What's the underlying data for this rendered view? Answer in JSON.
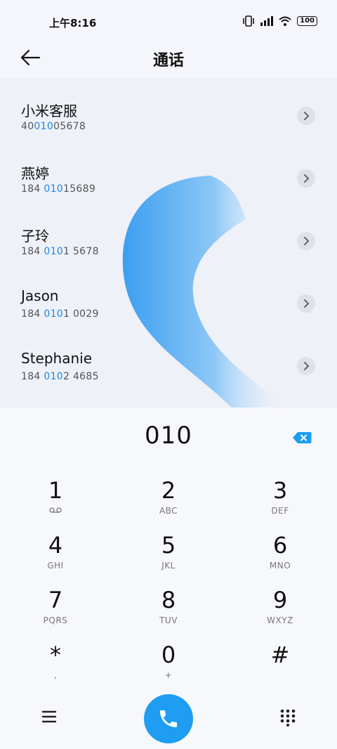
{
  "status_bar": {
    "time": "上午8:16",
    "battery": "100"
  },
  "header": {
    "title": "通话"
  },
  "contacts": [
    {
      "name": "小米客服",
      "number_pre": "40",
      "number_match": "010",
      "number_post": "05678"
    },
    {
      "name": "燕婷",
      "number_pre": "184 ",
      "number_match": "010",
      "number_post": "15689"
    },
    {
      "name": "子玲",
      "number_pre": "184 ",
      "number_match": "010",
      "number_post": "1 5678"
    },
    {
      "name": "Jason",
      "number_pre": "184 ",
      "number_match": "010",
      "number_post": "1 0029"
    },
    {
      "name": "Stephanie",
      "number_pre": "184 ",
      "number_match": "010",
      "number_post": "2 4685"
    }
  ],
  "dial_input": "010",
  "keys": [
    {
      "digit": "1",
      "letters": ""
    },
    {
      "digit": "2",
      "letters": "ABC"
    },
    {
      "digit": "3",
      "letters": "DEF"
    },
    {
      "digit": "4",
      "letters": "GHI"
    },
    {
      "digit": "5",
      "letters": "JKL"
    },
    {
      "digit": "6",
      "letters": "MNO"
    },
    {
      "digit": "7",
      "letters": "PQRS"
    },
    {
      "digit": "8",
      "letters": "TUV"
    },
    {
      "digit": "9",
      "letters": "WXYZ"
    },
    {
      "digit": "*",
      "letters": ","
    },
    {
      "digit": "0",
      "letters": "+"
    },
    {
      "digit": "#",
      "letters": ""
    }
  ],
  "colors": {
    "accent": "#1e9df3",
    "highlight": "#1e88e5"
  },
  "icons": {
    "back": "arrow-left-icon",
    "chevron": "chevron-right-icon",
    "backspace": "backspace-icon",
    "voicemail": "voicemail-icon",
    "menu": "menu-icon",
    "call": "phone-icon",
    "dialpad": "dialpad-icon"
  }
}
